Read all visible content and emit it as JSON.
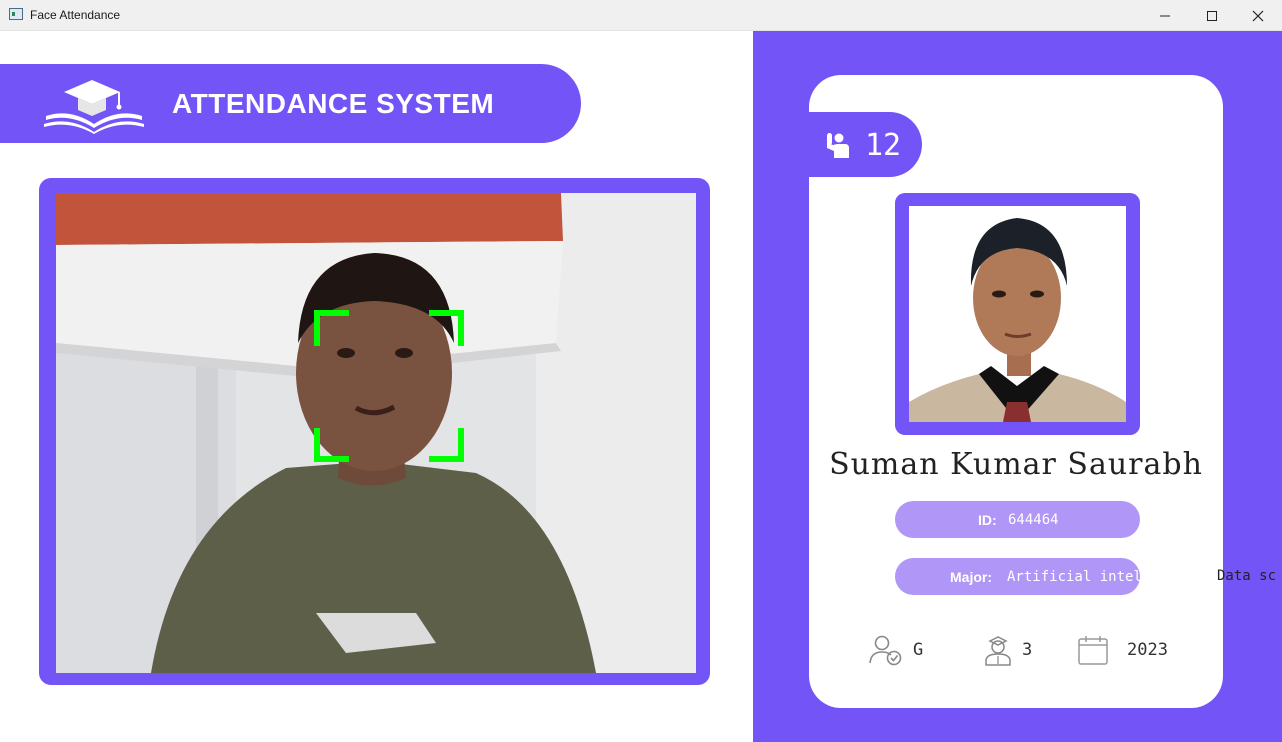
{
  "window": {
    "title": "Face Attendance",
    "minimize": "—",
    "maximize": "☐",
    "close": "✕"
  },
  "banner": {
    "title": "ATTENDANCE SYSTEM",
    "logo_icon": "graduation-cap-book-icon"
  },
  "camera": {
    "detection_color": "#00ff00"
  },
  "profile": {
    "total_attendance": "12",
    "name": "Suman Kumar Saurabh",
    "id_label": "ID:",
    "id_value": "644464",
    "major_label": "Major:",
    "major_value_in_pill": "Artificial intelli",
    "major_value_overflow": "Data sc",
    "standing": "G",
    "year": "3",
    "starting_year": "2023"
  },
  "colors": {
    "accent": "#7354f6",
    "pill": "#b096f6"
  }
}
